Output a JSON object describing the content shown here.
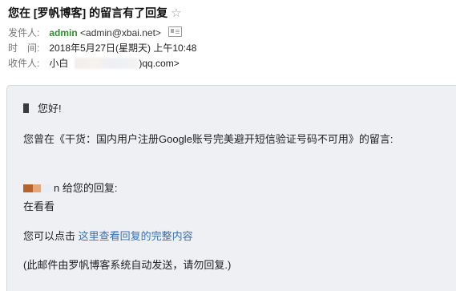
{
  "email": {
    "subject": "您在 [罗帆博客] 的留言有了回复",
    "from_label": "发件人:",
    "from_name": "admin",
    "from_addr": "<admin@xbai.net>",
    "time_label": "时　间:",
    "time_value": "2018年5月27日(星期天) 上午10:48",
    "to_label": "收件人:",
    "to_name": "小白",
    "to_addr_tail": ")qq.com>"
  },
  "body": {
    "greeting": "您好!",
    "intro": "您曾在《干货：国内用户注册Google账号完美避开短信验证号码不可用》的留言:",
    "reply_label": "n 给您的回复:",
    "reply_text": "在看看",
    "click_prefix": "您可以点击 ",
    "link_text": "这里查看回复的完整内容",
    "footer": "(此邮件由罗帆博客系统自动发送，请勿回复.)"
  },
  "icons": {
    "star": "star-outline-icon",
    "vcard": "contact-card-icon"
  },
  "colors": {
    "sender": "#2d8e2d",
    "link": "#3870b0",
    "content_bg": "#eef0f4"
  }
}
